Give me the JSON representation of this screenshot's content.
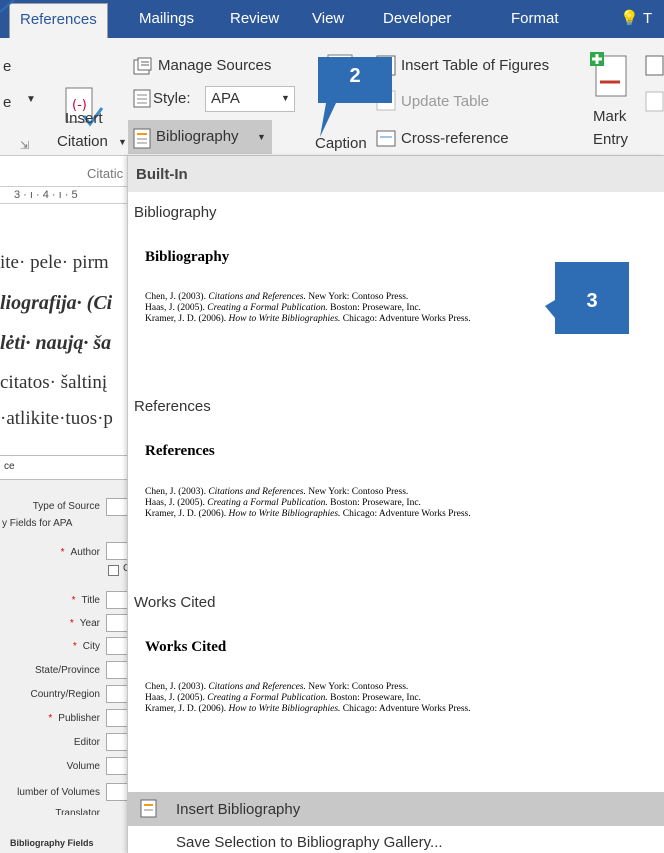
{
  "tabs": {
    "references": "References",
    "mailings": "Mailings",
    "review": "Review",
    "view": "View",
    "developer": "Developer",
    "format": "Format",
    "tell_partial": "T"
  },
  "ribbon": {
    "left_partial_1": "e",
    "left_partial_2": "e",
    "insert": "Insert",
    "citation": "Citation",
    "manage_sources": "Manage Sources",
    "style_label": "Style:",
    "style_value": "APA",
    "bibliography": "Bibliography",
    "group_citations": "Citatic",
    "caption": "Caption",
    "insert_table_of_figures": "Insert Table of Figures",
    "update_table": "Update Table",
    "cross_reference": "Cross-reference",
    "mark": "Mark",
    "entry": "Entry"
  },
  "callouts": {
    "step2": "2",
    "step3": "3"
  },
  "ruler": {
    "text": "3 · ı · 4 · ı · 5"
  },
  "document": {
    "line1": "ite· pele· pirm",
    "line2": "liografija· (Ci",
    "line3": "lėti· naują· ša",
    "line4": "citatos· šaltinį",
    "line5": "·atlikite·tuos·p"
  },
  "source_pane": {
    "search_partial": "ce",
    "type_of_source": "Type of Source",
    "fields_for": "y Fields for APA",
    "author": "Author",
    "title": "Title",
    "year": "Year",
    "city": "City",
    "state": "State/Province",
    "country": "Country/Region",
    "publisher": "Publisher",
    "editor": "Editor",
    "volume": "Volume",
    "number_of_volumes": "lumber of Volumes",
    "translator": "Translator",
    "bibliography_fields": "Bibliography Fields"
  },
  "gallery": {
    "header": "Built-In",
    "sections": [
      {
        "name": "Bibliography",
        "heading": "Bibliography",
        "citations": [
          {
            "pre": "Chen, J. (2003). ",
            "title": "Citations and References.",
            "post": " New York: Contoso Press."
          },
          {
            "pre": "Haas, J. (2005). ",
            "title": "Creating a Formal Publication.",
            "post": " Boston: Proseware, Inc."
          },
          {
            "pre": "Kramer, J. D. (2006). ",
            "title": "How to Write Bibliographies.",
            "post": " Chicago: Adventure Works Press."
          }
        ]
      },
      {
        "name": "References",
        "heading": "References",
        "citations": [
          {
            "pre": "Chen, J. (2003). ",
            "title": "Citations and References.",
            "post": " New York: Contoso Press."
          },
          {
            "pre": "Haas, J. (2005). ",
            "title": "Creating a Formal Publication.",
            "post": " Boston: Proseware, Inc."
          },
          {
            "pre": "Kramer, J. D. (2006). ",
            "title": "How to Write Bibliographies.",
            "post": " Chicago: Adventure Works Press."
          }
        ]
      },
      {
        "name": "Works Cited",
        "heading": "Works Cited",
        "citations": [
          {
            "pre": "Chen, J. (2003). ",
            "title": "Citations and References.",
            "post": " New York: Contoso Press."
          },
          {
            "pre": "Haas, J. (2005). ",
            "title": "Creating a Formal Publication.",
            "post": " Boston: Proseware, Inc."
          },
          {
            "pre": "Kramer, J. D. (2006). ",
            "title": "How to Write Bibliographies.",
            "post": " Chicago: Adventure Works Press."
          }
        ]
      }
    ],
    "insert_bibliography": "Insert Bibliography",
    "save_selection": "Save Selection to Bibliography Gallery..."
  },
  "colors": {
    "tabbar": "#2b579a",
    "callout": "#2e6db4",
    "hover": "#c8c8c8"
  }
}
